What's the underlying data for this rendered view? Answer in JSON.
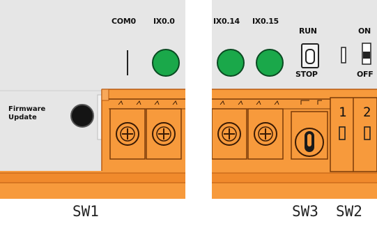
{
  "header": {
    "com": "COM0",
    "ix0": "IX0.0",
    "ix14": "IX0.14",
    "ix15": "IX0.15"
  },
  "run_stop": {
    "run": "RUN",
    "stop": "STOP"
  },
  "dip": {
    "on": "ON",
    "off": "OFF",
    "num1": "1",
    "num2": "2"
  },
  "firmware": {
    "line1": "Firmware",
    "line2": "Update"
  },
  "labels": {
    "sw1": "SW1",
    "sw3": "SW3",
    "sw2": "SW2"
  },
  "colors": {
    "panel": "#e6e6e6",
    "led_green": "#1aa84a",
    "terminal_orange": "#f79a3c",
    "frame_orange": "#f0862a"
  }
}
